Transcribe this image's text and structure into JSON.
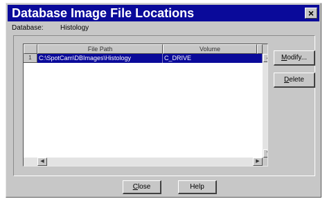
{
  "window": {
    "title": "Database Image File Locations",
    "close_glyph": "×"
  },
  "database": {
    "label": "Database:",
    "value": "Histology"
  },
  "table": {
    "columns": [
      "File Path",
      "Volume"
    ],
    "rows": [
      {
        "num": "1",
        "file_path": "C:\\SpotCam\\DBImages\\Histology",
        "volume": "C_DRIVE",
        "selected": true
      }
    ]
  },
  "scrollbar_icons": {
    "up": "up-arrow-icon",
    "down": "down-arrow-icon",
    "left": "left-arrow-icon",
    "right": "right-arrow-icon"
  },
  "buttons": {
    "modify": {
      "mnemonic": "M",
      "rest": "odify..."
    },
    "delete": {
      "mnemonic": "D",
      "rest": "elete"
    },
    "close": {
      "mnemonic": "C",
      "rest": "lose"
    },
    "help": "Help"
  },
  "colors": {
    "titlebar": "#0a0a9a",
    "selection": "#0a0a9a",
    "dialog": "#c7c7c7"
  }
}
